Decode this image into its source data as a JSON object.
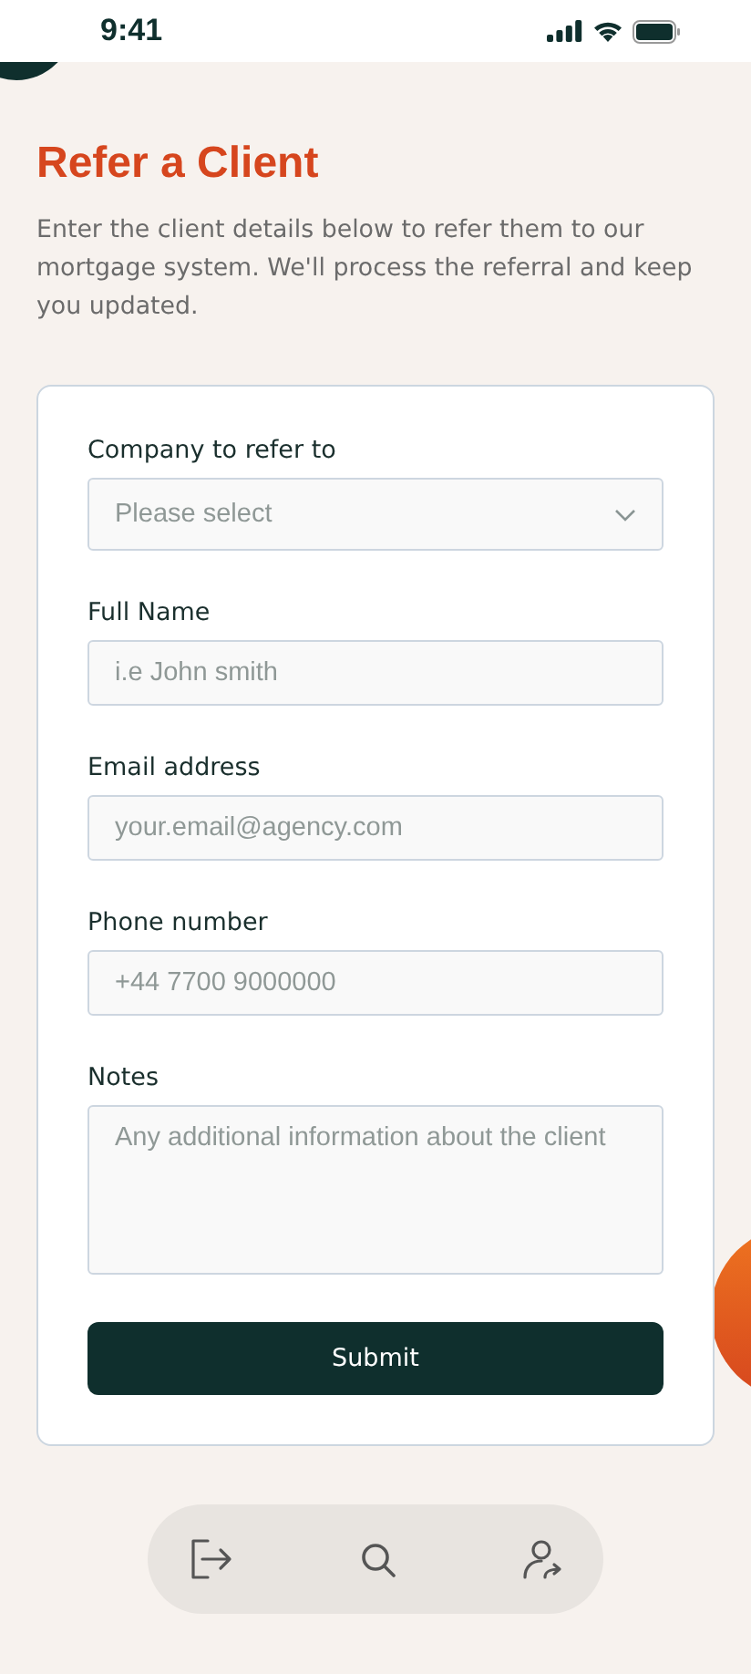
{
  "status_bar": {
    "time": "9:41"
  },
  "title": "Refer a Client",
  "description": "Enter the client details below to refer them to our mortgage system. We'll process the referral and keep you updated.",
  "form": {
    "fields": [
      {
        "kind": "select",
        "label": "Company to refer to",
        "placeholder": "Please select"
      },
      {
        "kind": "input",
        "label": "Full Name",
        "placeholder": "i.e John smith"
      },
      {
        "kind": "input",
        "label": "Email address",
        "placeholder": "your.email@agency.com"
      },
      {
        "kind": "input",
        "label": "Phone number",
        "placeholder": "+44 7700 9000000"
      },
      {
        "kind": "textarea",
        "label": "Notes",
        "placeholder": "Any additional information about the client"
      }
    ],
    "submit": "Submit"
  }
}
